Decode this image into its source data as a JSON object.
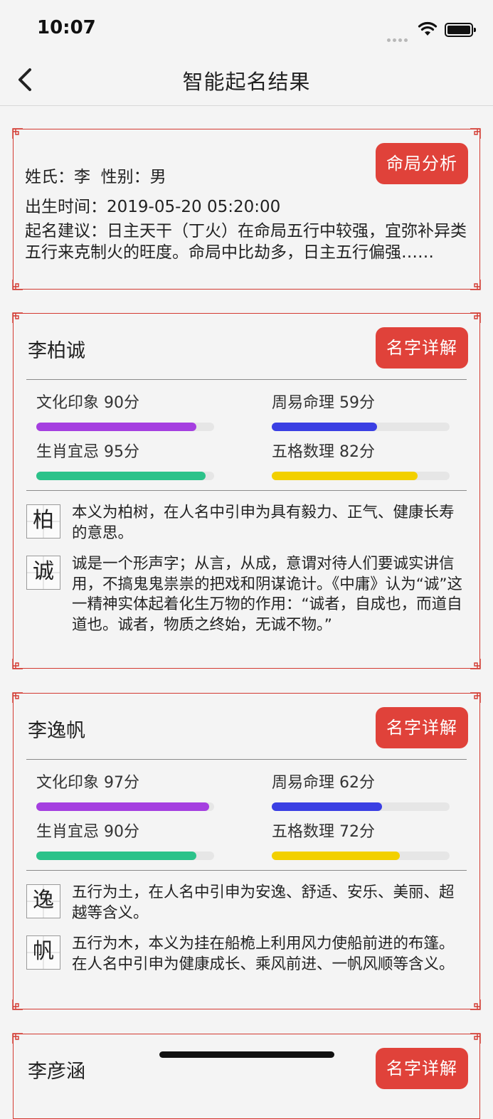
{
  "status_bar": {
    "time": "10:07"
  },
  "nav": {
    "title": "智能起名结果"
  },
  "info_card": {
    "button_label": "命局分析",
    "surname_gender": "姓氏：李  性别：男",
    "birth": "出生时间：2019-05-20 05:20:00",
    "advice": "起名建议：日主天干（丁火）在命局五行中较强，宜弥补异类五行来克制火的旺度。命局中比劫多，日主五行偏强……"
  },
  "names": [
    {
      "name": "李柏诚",
      "button_label": "名字详解",
      "scores": [
        {
          "label": "文化印象 90分",
          "value": 90
        },
        {
          "label": "周易命理 59分",
          "value": 59
        },
        {
          "label": "生肖宜忌 95分",
          "value": 95
        },
        {
          "label": "五格数理 82分",
          "value": 82
        }
      ],
      "chars": [
        {
          "char": "柏",
          "desc": "本义为柏树，在人名中引申为具有毅力、正气、健康长寿的意思。"
        },
        {
          "char": "诚",
          "desc": "诚是一个形声字；从言，从成，意谓对待人们要诚实讲信用，不搞鬼鬼祟祟的把戏和阴谋诡计。《中庸》认为“诚”这一精神实体起着化生万物的作用：“诚者，自成也，而道自道也。诚者，物质之终始，无诚不物。”"
        }
      ]
    },
    {
      "name": "李逸帆",
      "button_label": "名字详解",
      "scores": [
        {
          "label": "文化印象 97分",
          "value": 97
        },
        {
          "label": "周易命理 62分",
          "value": 62
        },
        {
          "label": "生肖宜忌 90分",
          "value": 90
        },
        {
          "label": "五格数理 72分",
          "value": 72
        }
      ],
      "chars": [
        {
          "char": "逸",
          "desc": "五行为土，在人名中引申为安逸、舒适、安乐、美丽、超越等含义。"
        },
        {
          "char": "帆",
          "desc": "五行为木，本义为挂在船桅上利用风力使船前进的布篷。在人名中引申为健康成长、乘风前进、一帆风顺等含义。"
        }
      ]
    },
    {
      "name": "李彦涵",
      "button_label": "名字详解"
    }
  ],
  "colors": {
    "accent": "#e0423a",
    "border": "#d33a31",
    "score_culture": "#a53fe0",
    "score_zhouyi": "#3a3fe3",
    "score_zodiac": "#2cc28a",
    "score_wuge": "#f2d000"
  }
}
